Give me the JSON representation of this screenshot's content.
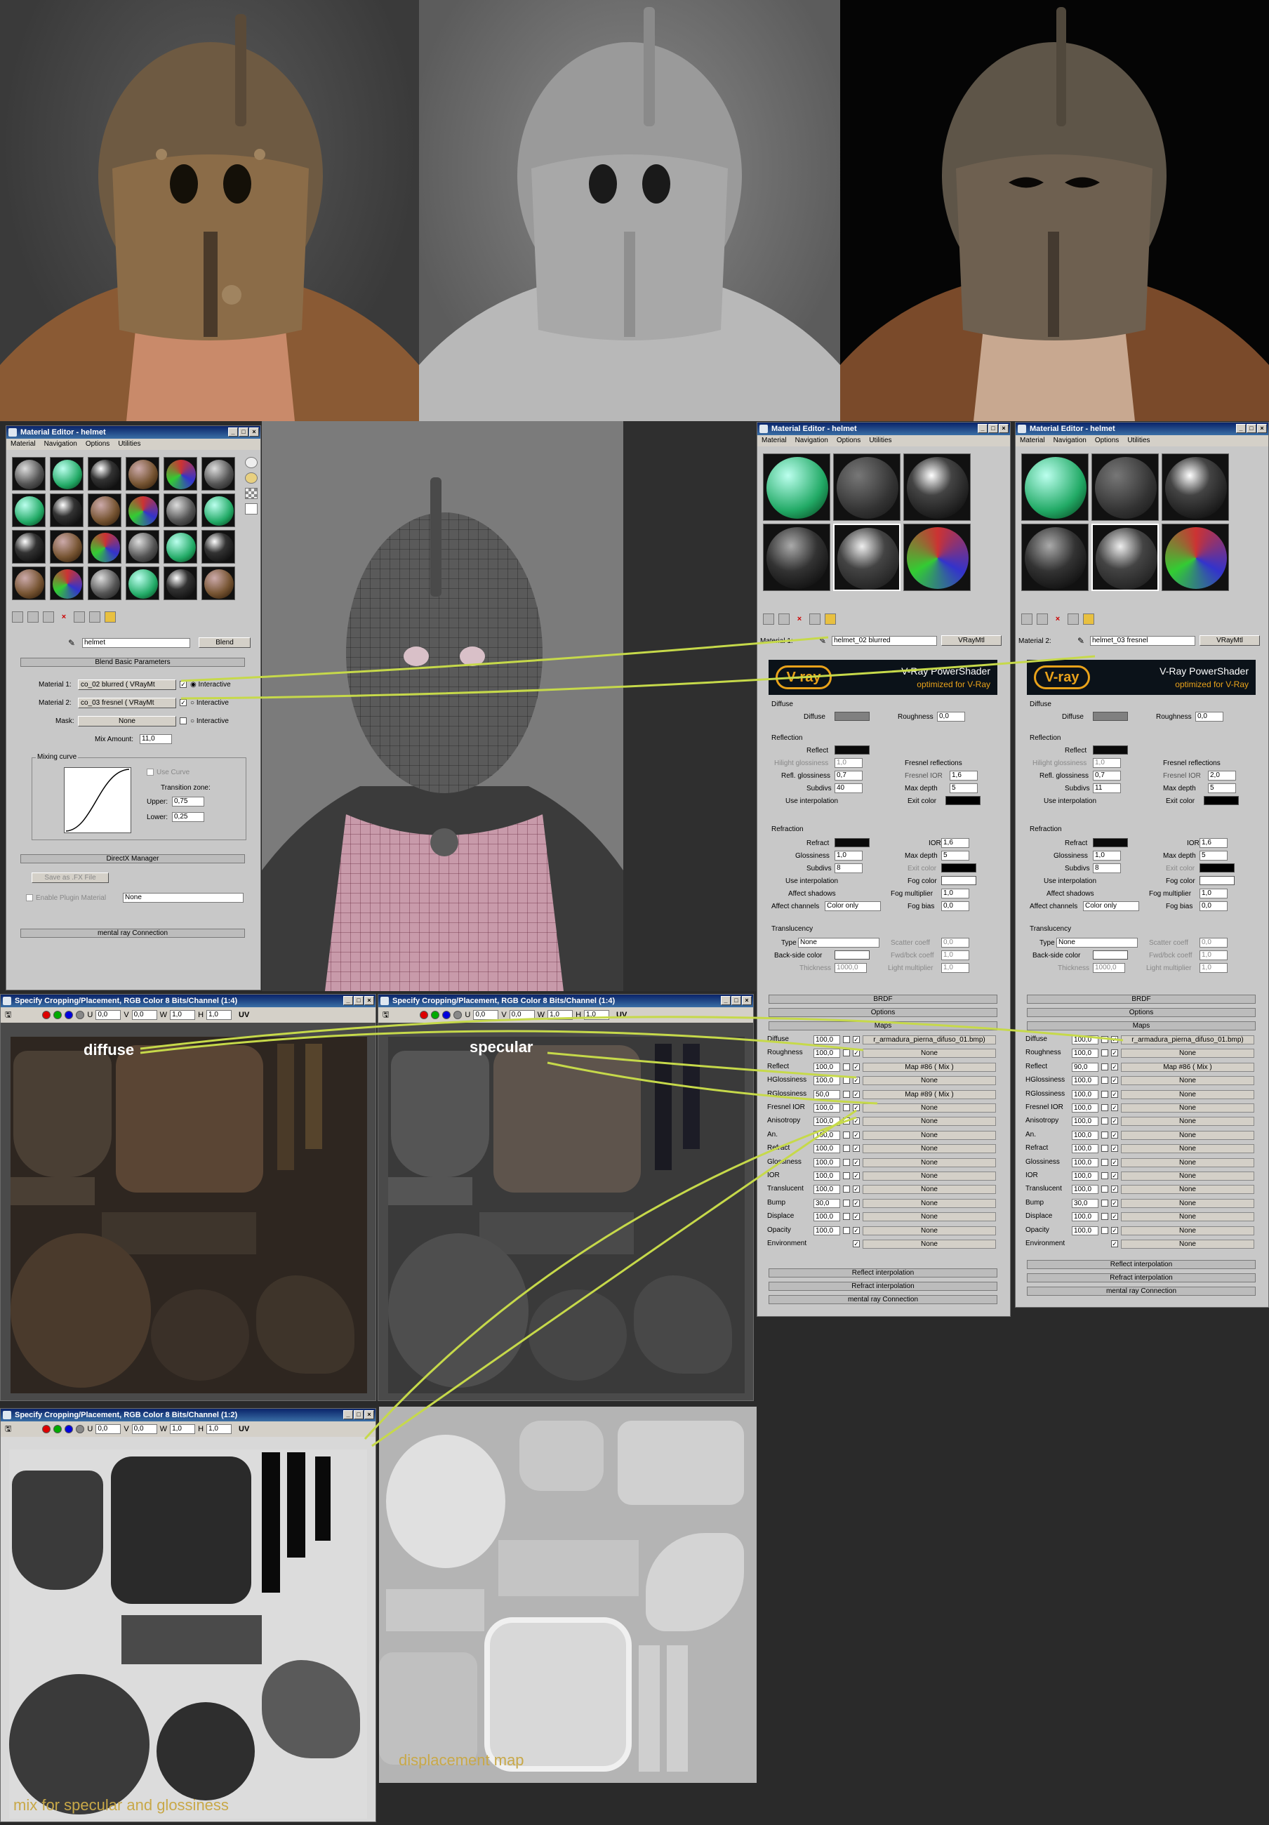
{
  "renders": {
    "icons": [
      "helmet-render-textured",
      "helmet-render-clay",
      "helmet-render-vray"
    ]
  },
  "mat_editor_left": {
    "title": "Material Editor - helmet",
    "menu": [
      "Material",
      "Navigation",
      "Options",
      "Utilities"
    ],
    "material_name": "helmet",
    "type_button": "Blend",
    "rollout_blend": "Blend Basic Parameters",
    "mat1_label": "Material 1:",
    "mat1_value": "co_02 blurred  ( VRayMt",
    "mat2_label": "Material 2:",
    "mat2_value": "co_03 fresnel  ( VRayMt",
    "mask_label": "Mask:",
    "mask_value": "None",
    "interactive": "Interactive",
    "mix_amount_label": "Mix Amount:",
    "mix_amount": "11,0",
    "mixing_curve": "Mixing curve",
    "use_curve": "Use Curve",
    "transition_zone": "Transition zone:",
    "upper_label": "Upper:",
    "upper": "0,75",
    "lower_label": "Lower:",
    "lower": "0,25",
    "rollout_directx": "DirectX Manager",
    "save_fx": "Save as .FX File",
    "enable_plugin": "Enable Plugin Material",
    "plugin_value": "None",
    "rollout_mental": "mental ray Connection"
  },
  "mat_editor_mid": {
    "title": "Material Editor - helmet",
    "menu": [
      "Material",
      "Navigation",
      "Options",
      "Utilities"
    ],
    "material_label": "Material 1:",
    "material_name": "helmet_02 blurred",
    "type_button": "VRayMtl",
    "vray_title": "V-Ray PowerShader",
    "vray_sub": "optimized for V-Ray",
    "diffuse_group": "Diffuse",
    "diffuse": "Diffuse",
    "roughness": "Roughness",
    "roughness_val": "0,0",
    "reflection_group": "Reflection",
    "reflect": "Reflect",
    "hilight_gloss": "Hilight glossiness",
    "hilight_val": "1,0",
    "refl_gloss": "Refl. glossiness",
    "refl_gloss_val": "0,7",
    "subdivs": "Subdivs",
    "subdivs_val": "40",
    "use_interp": "Use interpolation",
    "fresnel_refl": "Fresnel reflections",
    "fresnel_ior": "Fresnel IOR",
    "fresnel_ior_val": "1,6",
    "max_depth": "Max depth",
    "max_depth_val": "5",
    "exit_color": "Exit color",
    "refraction_group": "Refraction",
    "refract": "Refract",
    "ior": "IOR",
    "ior_val": "1,6",
    "glossiness": "Glossiness",
    "gloss_val": "1,0",
    "r_max_depth_val": "5",
    "r_subdivs_val": "8",
    "fog_color": "Fog color",
    "affect_shadows": "Affect shadows",
    "fog_mult": "Fog multiplier",
    "fog_mult_val": "1,0",
    "affect_channels": "Affect channels",
    "channels_val": "Color only",
    "fog_bias": "Fog bias",
    "fog_bias_val": "0,0",
    "transl_group": "Translucency",
    "type": "Type",
    "type_val": "None",
    "scatter": "Scatter coeff",
    "scatter_val": "0,0",
    "backside": "Back-side color",
    "fwd_bck": "Fwd/bck coeff",
    "fwd_val": "1,0",
    "thickness": "Thickness",
    "thick_val": "1000,0",
    "light_mult": "Light multiplier",
    "light_val": "1,0",
    "brdf": "BRDF",
    "options": "Options",
    "maps": "Maps",
    "map_rows": [
      {
        "name": "Diffuse",
        "val": "100,0",
        "map": "r_armadura_pierna_difuso_01.bmp)"
      },
      {
        "name": "Roughness",
        "val": "100,0",
        "map": "None"
      },
      {
        "name": "Reflect",
        "val": "100,0",
        "map": "Map #86  ( Mix )"
      },
      {
        "name": "HGlossiness",
        "val": "100,0",
        "map": "None"
      },
      {
        "name": "RGlossiness",
        "val": "50,0",
        "map": "Map #89  ( Mix )"
      },
      {
        "name": "Fresnel IOR",
        "val": "100,0",
        "map": "None"
      },
      {
        "name": "Anisotropy",
        "val": "100,0",
        "map": "None"
      },
      {
        "name": "An.",
        "val": "100,0",
        "map": "None"
      },
      {
        "name": "Refract",
        "val": "100,0",
        "map": "None"
      },
      {
        "name": "Glossiness",
        "val": "100,0",
        "map": "None"
      },
      {
        "name": "IOR",
        "val": "100,0",
        "map": "None"
      },
      {
        "name": "Translucent",
        "val": "100,0",
        "map": "None"
      },
      {
        "name": "Bump",
        "val": "30,0",
        "map": "None"
      },
      {
        "name": "Displace",
        "val": "100,0",
        "map": "None"
      },
      {
        "name": "Opacity",
        "val": "100,0",
        "map": "None"
      },
      {
        "name": "Environment",
        "val": "",
        "map": "None"
      }
    ],
    "refl_interp": "Reflect interpolation",
    "refr_interp": "Refract interpolation",
    "mental": "mental ray Connection"
  },
  "mat_editor_right": {
    "title": "Material Editor - helmet",
    "menu": [
      "Material",
      "Navigation",
      "Options",
      "Utilities"
    ],
    "material_label": "Material 2:",
    "material_name": "helmet_03 fresnel",
    "type_button": "VRayMtl",
    "vray_title": "V-Ray PowerShader",
    "vray_sub": "optimized for V-Ray",
    "diffuse_group": "Diffuse",
    "diffuse": "Diffuse",
    "roughness": "Roughness",
    "roughness_val": "0,0",
    "reflection_group": "Reflection",
    "reflect": "Reflect",
    "hilight_gloss": "Hilight glossiness",
    "hilight_val": "1,0",
    "refl_gloss": "Refl. glossiness",
    "refl_gloss_val": "0,7",
    "subdivs": "Subdivs",
    "subdivs_val": "11",
    "use_interp": "Use interpolation",
    "fresnel_refl": "Fresnel reflections",
    "fresnel_ior": "Fresnel IOR",
    "fresnel_ior_val": "2,0",
    "max_depth": "Max depth",
    "max_depth_val": "5",
    "exit_color": "Exit color",
    "refraction_group": "Refraction",
    "refract": "Refract",
    "ior": "IOR",
    "ior_val": "1,6",
    "glossiness": "Glossiness",
    "gloss_val": "1,0",
    "r_max_depth_val": "5",
    "r_subdivs_val": "8",
    "fog_color": "Fog color",
    "affect_shadows": "Affect shadows",
    "fog_mult": "Fog multiplier",
    "fog_mult_val": "1,0",
    "affect_channels": "Affect channels",
    "channels_val": "Color only",
    "fog_bias": "Fog bias",
    "fog_bias_val": "0,0",
    "transl_group": "Translucency",
    "type": "Type",
    "type_val": "None",
    "scatter": "Scatter coeff",
    "scatter_val": "0,0",
    "backside": "Back-side color",
    "fwd_bck": "Fwd/bck coeff",
    "fwd_val": "1,0",
    "thickness": "Thickness",
    "thick_val": "1000,0",
    "light_mult": "Light multiplier",
    "light_val": "1,0",
    "brdf": "BRDF",
    "options": "Options",
    "maps": "Maps",
    "map_rows": [
      {
        "name": "Diffuse",
        "val": "100,0",
        "map": "r_armadura_pierna_difuso_01.bmp)"
      },
      {
        "name": "Roughness",
        "val": "100,0",
        "map": "None"
      },
      {
        "name": "Reflect",
        "val": "90,0",
        "map": "Map #86  ( Mix )"
      },
      {
        "name": "HGlossiness",
        "val": "100,0",
        "map": "None"
      },
      {
        "name": "RGlossiness",
        "val": "100,0",
        "map": "None"
      },
      {
        "name": "Fresnel IOR",
        "val": "100,0",
        "map": "None"
      },
      {
        "name": "Anisotropy",
        "val": "100,0",
        "map": "None"
      },
      {
        "name": "An.",
        "val": "100,0",
        "map": "None"
      },
      {
        "name": "Refract",
        "val": "100,0",
        "map": "None"
      },
      {
        "name": "Glossiness",
        "val": "100,0",
        "map": "None"
      },
      {
        "name": "IOR",
        "val": "100,0",
        "map": "None"
      },
      {
        "name": "Translucent",
        "val": "100,0",
        "map": "None"
      },
      {
        "name": "Bump",
        "val": "30,0",
        "map": "None"
      },
      {
        "name": "Displace",
        "val": "100,0",
        "map": "None"
      },
      {
        "name": "Opacity",
        "val": "100,0",
        "map": "None"
      },
      {
        "name": "Environment",
        "val": "",
        "map": "None"
      }
    ],
    "refl_interp": "Reflect interpolation",
    "refr_interp": "Refract interpolation",
    "mental": "mental ray Connection"
  },
  "crop1": {
    "title": "Specify Cropping/Placement, RGB Color 8 Bits/Channel (1:4)",
    "u": "0,0",
    "v": "0,0",
    "w": "1,0",
    "h": "1,0",
    "uv": "UV",
    "label": "diffuse"
  },
  "crop2": {
    "title": "Specify Cropping/Placement, RGB Color 8 Bits/Channel (1:4)",
    "u": "0,0",
    "v": "0,0",
    "w": "1,0",
    "h": "1,0",
    "uv": "UV",
    "label": "specular"
  },
  "crop3": {
    "title": "Specify Cropping/Placement, RGB Color 8 Bits/Channel (1:2)",
    "u": "0,0",
    "v": "0,0",
    "w": "1,0",
    "h": "1,0",
    "uv": "UV",
    "label": "mix for specular and glossiness"
  },
  "disp": {
    "label": "displacement map"
  },
  "colors": {
    "annotation_line": "#c6d94a",
    "titlebar": "#0a246a"
  }
}
